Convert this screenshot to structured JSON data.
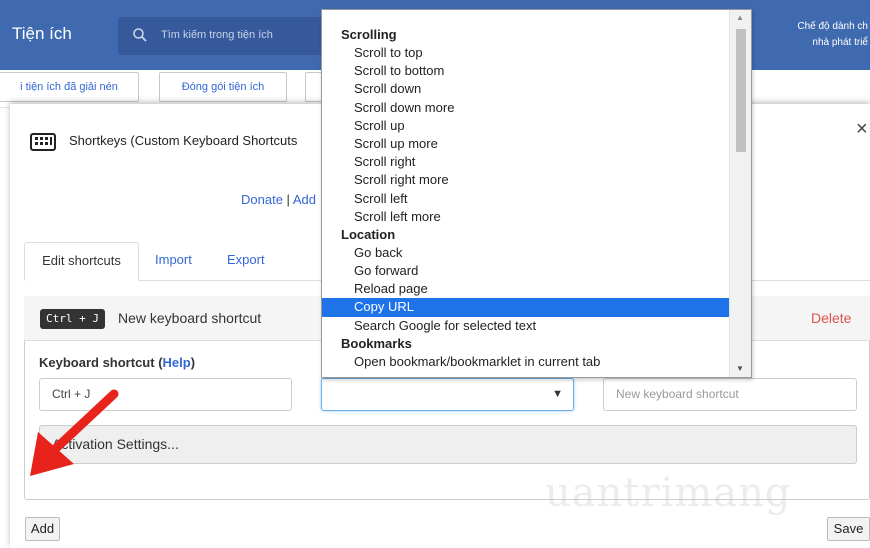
{
  "header": {
    "title": "Tiện ích",
    "search_placeholder": "Tìm kiếm trong tiện ích",
    "dev_mode_line1": "Chế độ dành ch",
    "dev_mode_line2": "nhà phát triể",
    "color": "#3f6ab0"
  },
  "toolbar": {
    "load_unpacked": "i tiện ích đã giải nén",
    "pack_extension": "Đóng gói tiện ích"
  },
  "extension": {
    "name": "Shortkeys (Custom Keyboard Shortcuts",
    "donate": "Donate",
    "separator": "|",
    "add_link": "Add"
  },
  "tabs": [
    {
      "label": "Edit shortcuts",
      "active": true
    },
    {
      "label": "Import",
      "active": false
    },
    {
      "label": "Export",
      "active": false
    }
  ],
  "shortcut": {
    "kbd": "Ctrl + J",
    "title": "New keyboard shortcut",
    "delete_label": "Delete",
    "field_label": "Keyboard shortcut",
    "help_label": "Help",
    "paren_open": " (",
    "paren_close": ")",
    "shortcut_value": "Ctrl + J",
    "action_value": "",
    "name_placeholder": "New keyboard shortcut",
    "activation_label": "Activation Settings..."
  },
  "buttons": {
    "add": "Add",
    "save": "Save"
  },
  "watermark": "uantrimang",
  "dropdown": {
    "items": [
      {
        "type": "group",
        "label": "Scrolling"
      },
      {
        "type": "option",
        "label": "Scroll to top"
      },
      {
        "type": "option",
        "label": "Scroll to bottom"
      },
      {
        "type": "option",
        "label": "Scroll down"
      },
      {
        "type": "option",
        "label": "Scroll down more"
      },
      {
        "type": "option",
        "label": "Scroll up"
      },
      {
        "type": "option",
        "label": "Scroll up more"
      },
      {
        "type": "option",
        "label": "Scroll right"
      },
      {
        "type": "option",
        "label": "Scroll right more"
      },
      {
        "type": "option",
        "label": "Scroll left"
      },
      {
        "type": "option",
        "label": "Scroll left more"
      },
      {
        "type": "group",
        "label": "Location"
      },
      {
        "type": "option",
        "label": "Go back"
      },
      {
        "type": "option",
        "label": "Go forward"
      },
      {
        "type": "option",
        "label": "Reload page"
      },
      {
        "type": "option",
        "label": "Copy URL",
        "selected": true
      },
      {
        "type": "option",
        "label": "Search Google for selected text"
      },
      {
        "type": "group",
        "label": "Bookmarks"
      },
      {
        "type": "option",
        "label": "Open bookmark/bookmarklet in current tab"
      }
    ],
    "highlight_color": "#1e73e8"
  }
}
